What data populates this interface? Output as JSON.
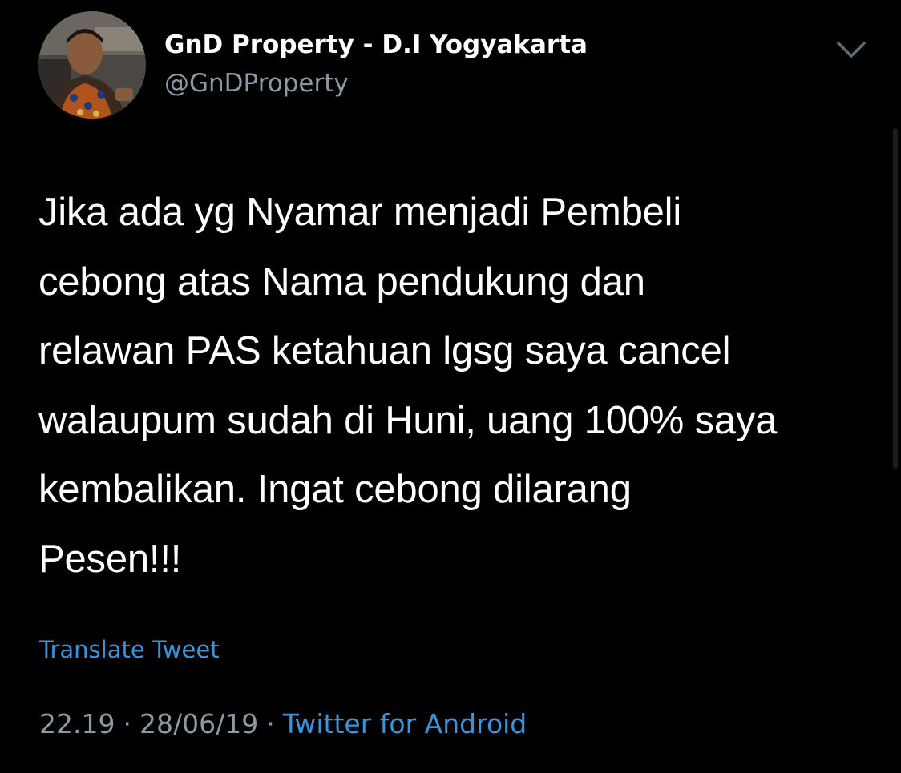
{
  "author": {
    "display_name": "GnD Property - D.I Yogyakarta",
    "handle": "@GnDProperty",
    "avatar_icon": "profile-photo"
  },
  "tweet": {
    "text": "Jika ada yg Nyamar menjadi Pembeli\ncebong atas Nama pendukung dan\nrelawan PAS ketahuan lgsg saya cancel\nwalaupum sudah di Huni, uang 100% saya\nkembalikan. Ingat cebong dilarang\nPesen!!!",
    "translate_label": "Translate Tweet",
    "time": "22.19",
    "date": "28/06/19",
    "separator": "·",
    "source": "Twitter for Android"
  },
  "menu_icon": "chevron-down-icon",
  "colors": {
    "background": "#000000",
    "primary_text": "#ffffff",
    "secondary_text": "#8b98a5",
    "link": "#3b94d9"
  }
}
